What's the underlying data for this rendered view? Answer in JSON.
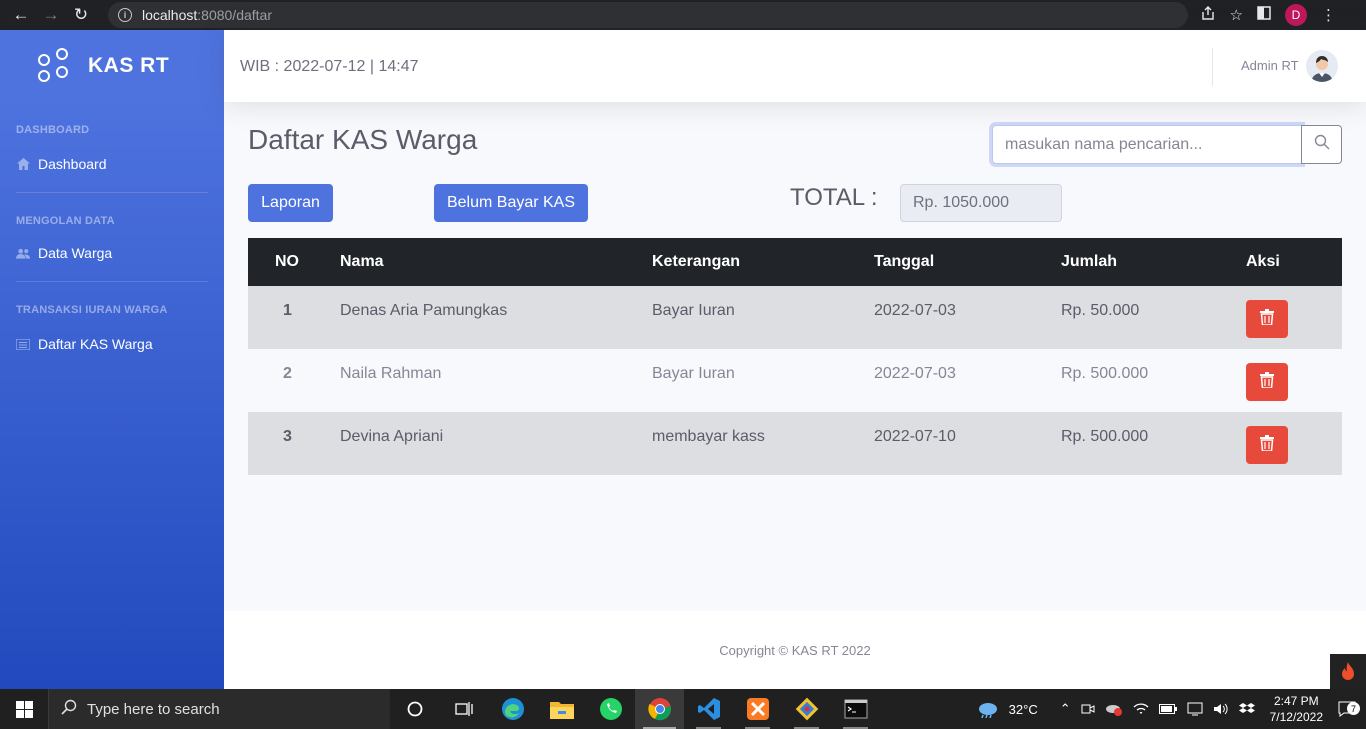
{
  "browser": {
    "url_host": "localhost",
    "url_rest": ":8080/daftar",
    "profile_initial": "D"
  },
  "sidebar": {
    "brand": "KAS RT",
    "sections": [
      {
        "heading": "DASHBOARD",
        "item": "Dashboard",
        "icon": "home-icon"
      },
      {
        "heading": "MENGOLAN DATA",
        "item": "Data Warga",
        "icon": "users-icon"
      },
      {
        "heading": "TRANSAKSI IURAN WARGA",
        "item": "Daftar KAS Warga",
        "icon": "list-icon"
      }
    ]
  },
  "topbar": {
    "clock": "WIB : 2022-07-12 | 14:47",
    "user_name": "Admin RT"
  },
  "main": {
    "title": "Daftar KAS Warga",
    "search_placeholder": "masukan nama pencarian...",
    "btn_laporan": "Laporan",
    "btn_belum_bayar": "Belum Bayar KAS",
    "total_label": "TOTAL :",
    "total_value": "Rp. 1050.000"
  },
  "table": {
    "headers": [
      "NO",
      "Nama",
      "Keterangan",
      "Tanggal",
      "Jumlah",
      "Aksi"
    ],
    "rows": [
      [
        "1",
        "Denas Aria Pamungkas",
        "Bayar Iuran",
        "2022-07-03",
        "Rp. 50.000"
      ],
      [
        "2",
        "Naila Rahman",
        "Bayar Iuran",
        "2022-07-03",
        "Rp. 500.000"
      ],
      [
        "3",
        "Devina Apriani",
        "membayar kass",
        "2022-07-10",
        "Rp. 500.000"
      ]
    ]
  },
  "footer": {
    "copyright": "Copyright © KAS RT 2022"
  },
  "taskbar": {
    "search_placeholder": "Type here to search",
    "weather": "32°C",
    "time": "2:47 PM",
    "date": "7/12/2022",
    "notification_count": "7"
  },
  "colors": {
    "primary": "#4e73df",
    "danger": "#e74a3b",
    "table_head": "#212529"
  }
}
